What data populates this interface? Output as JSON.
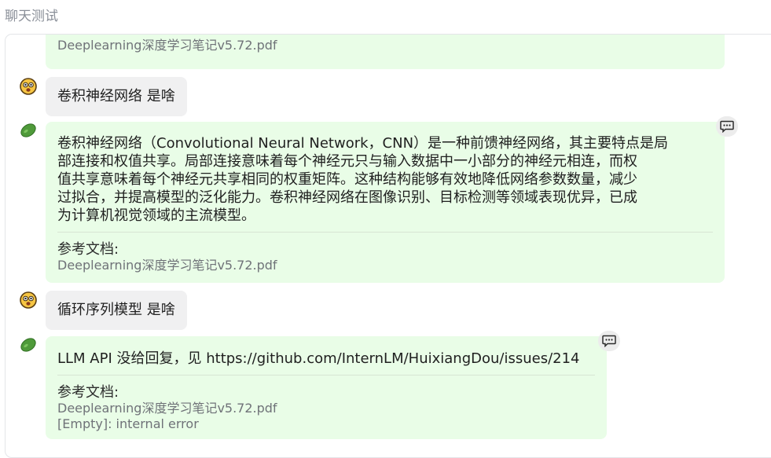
{
  "page": {
    "title": "聊天测试"
  },
  "chat": {
    "top_ref_doc": "Deeplearning深度学习笔记v5.72.pdf",
    "messages": [
      {
        "role": "user",
        "text": "卷积神经网络 是啥"
      },
      {
        "role": "bot",
        "lines": [
          "卷积神经网络（Convolutional Neural Network，CNN）是一种前馈神经网络，其主要特点是局",
          "部连接和权值共享。局部连接意味着每个神经元只与输入数据中一小部分的神经元相连，而权",
          "值共享意味着每个神经元共享相同的权重矩阵。这种结构能够有效地降低网络参数数量，减少",
          "过拟合，并提高模型的泛化能力。卷积神经网络在图像识别、目标检测等领域表现优异，已成",
          "为计算机视觉领域的主流模型。"
        ],
        "ref_title": "参考文档:",
        "refs": [
          "Deeplearning深度学习笔记v5.72.pdf"
        ]
      },
      {
        "role": "user",
        "text": "循环序列模型 是啥"
      },
      {
        "role": "bot",
        "text": "LLM API 没给回复，见 https://github.com/InternLM/HuixiangDou/issues/214",
        "ref_title": "参考文档:",
        "refs": [
          "Deeplearning深度学习笔记v5.72.pdf",
          "[Empty]: internal error"
        ]
      }
    ]
  },
  "icons": {
    "user_avatar": "emoji-face-icon",
    "bot_avatar": "bean-icon",
    "copy": "chat-bubble-icon"
  },
  "colors": {
    "user_bubble": "#f0f0f1",
    "bot_bubble": "#e9fde7",
    "title_gray": "#8a8f98",
    "ref_doc_gray": "#6f7278",
    "bean_green": "#4f9a3a"
  }
}
